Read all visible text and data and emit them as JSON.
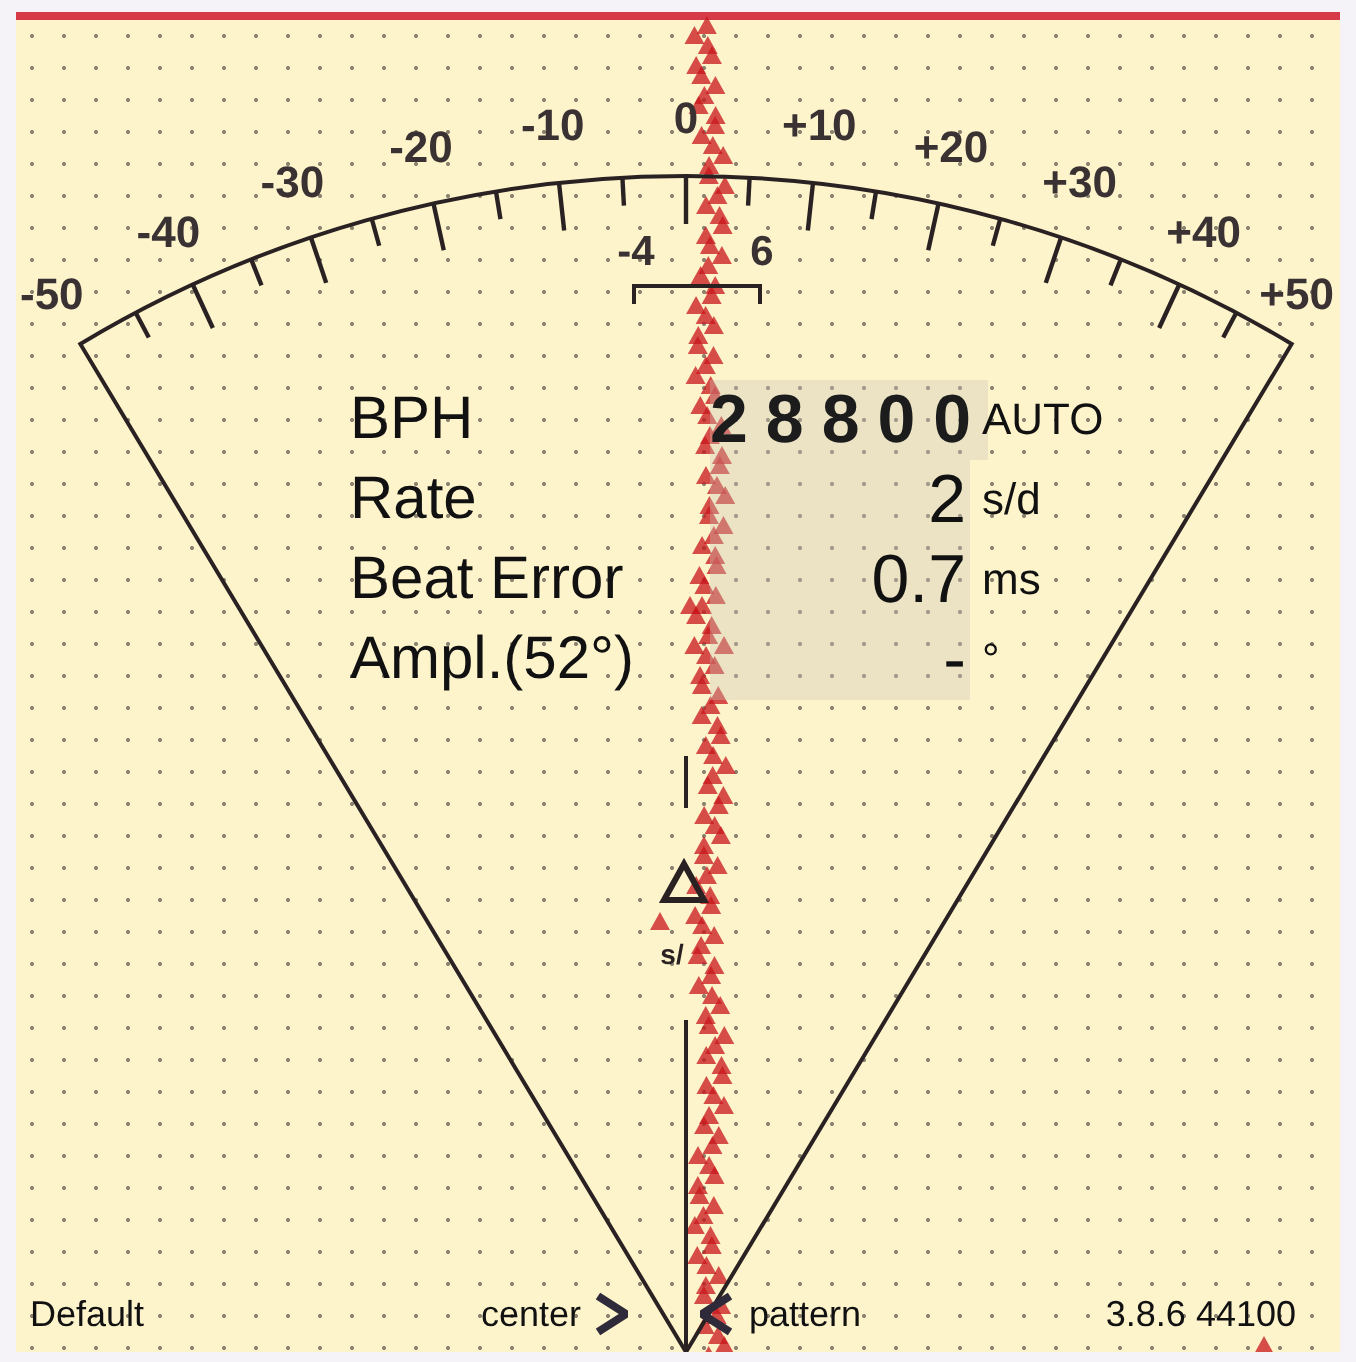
{
  "scale": {
    "labels": [
      "-50",
      "-40",
      "-30",
      "-20",
      "-10",
      "0",
      "+10",
      "+20",
      "+30",
      "+40",
      "+50"
    ],
    "zoom_labels": [
      "-4",
      "6"
    ]
  },
  "readouts": [
    {
      "label": "BPH",
      "value": "28800",
      "unit": "AUTO",
      "kind": "digits"
    },
    {
      "label": "Rate",
      "value": "2",
      "unit": "s/d",
      "kind": "plain"
    },
    {
      "label": "Beat Error",
      "value": "0.7",
      "unit": "ms",
      "kind": "plain"
    },
    {
      "label": "Ampl.(52°)",
      "value": "-",
      "unit": "°",
      "kind": "plain"
    }
  ],
  "marker": {
    "text": "s/"
  },
  "footer": {
    "profile": "Default",
    "left_mode": "center",
    "right_mode": "pattern",
    "version": "3.8.6 44100"
  }
}
